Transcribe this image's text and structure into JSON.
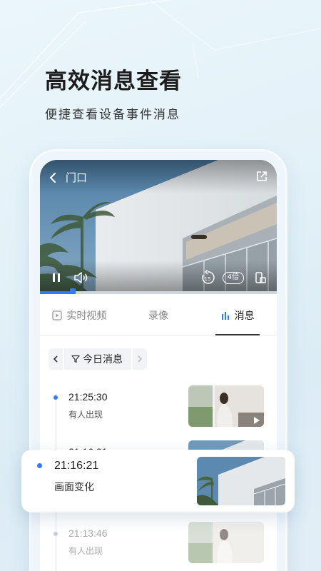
{
  "hero": {
    "title": "高效消息查看",
    "subtitle": "便捷查看设备事件消息"
  },
  "player": {
    "camera_name": "门口",
    "speed_label": "4倍",
    "rewind_seconds": "15",
    "progress": 0.14
  },
  "tabs": [
    {
      "label": "实时视频",
      "icon": "play-box-icon",
      "active": false
    },
    {
      "label": "录像",
      "icon": "",
      "active": false
    },
    {
      "label": "消息",
      "icon": "bar-chart-icon",
      "active": true
    }
  ],
  "date_filter": {
    "label": "今日消息"
  },
  "events": [
    {
      "time": "21:25:30",
      "desc": "有人出现",
      "thumb": "person-room"
    },
    {
      "time": "21:16:21",
      "desc": "",
      "thumb": "building"
    },
    {
      "time": "21:13:46",
      "desc": "有人出现",
      "thumb": "person-room"
    }
  ],
  "highlight_event": {
    "time": "21:16:21",
    "desc": "画面变化",
    "thumb": "building"
  },
  "colors": {
    "accent": "#2f7cf6",
    "background": "#e3f1f8",
    "text": "#222222"
  }
}
